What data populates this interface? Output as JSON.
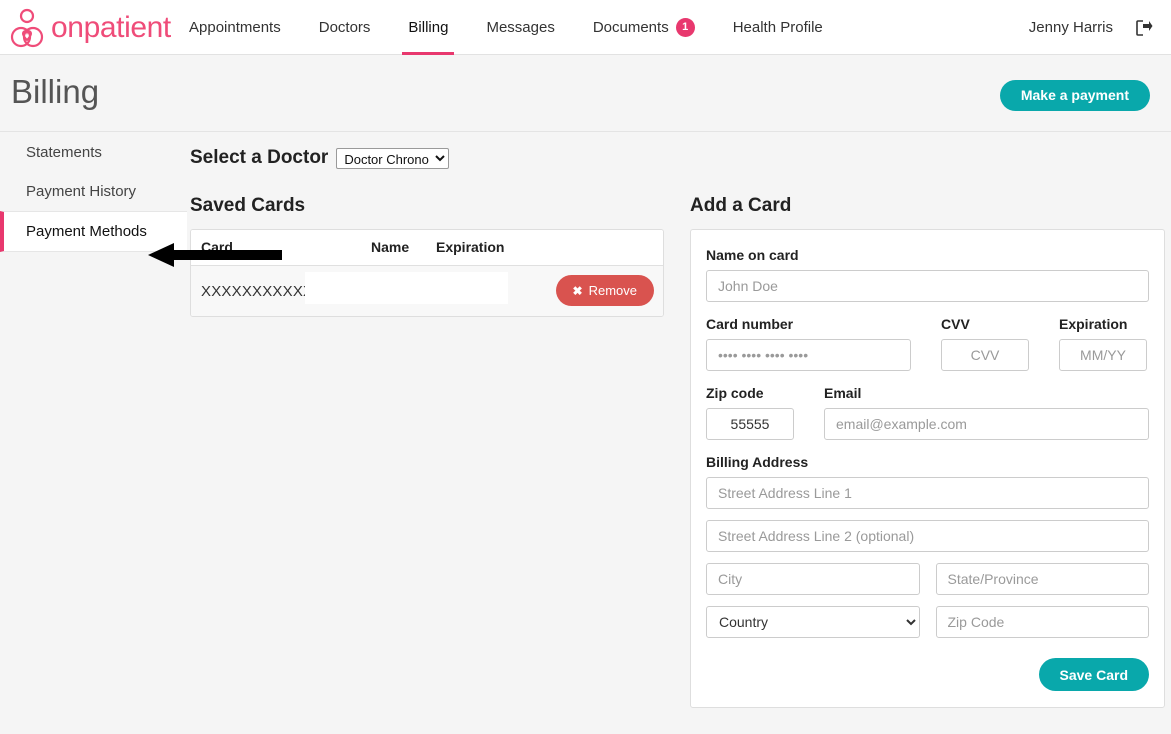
{
  "navbar": {
    "brand": "onpatient",
    "brand_icon": "person-heart-logo-icon",
    "links": [
      {
        "label": "Appointments",
        "active": false
      },
      {
        "label": "Doctors",
        "active": false
      },
      {
        "label": "Billing",
        "active": true
      },
      {
        "label": "Messages",
        "active": false
      },
      {
        "label": "Documents",
        "active": false,
        "badge": "1"
      },
      {
        "label": "Health Profile",
        "active": false
      }
    ],
    "user_name": "Jenny Harris",
    "logout_icon": "logout-icon"
  },
  "page": {
    "title": "Billing",
    "make_payment_label": "Make a payment"
  },
  "sidebar": {
    "items": [
      {
        "label": "Statements",
        "active": false
      },
      {
        "label": "Payment History",
        "active": false
      },
      {
        "label": "Payment Methods",
        "active": true
      }
    ]
  },
  "doctor": {
    "label": "Select a Doctor",
    "selected": "Doctor Chrono",
    "options": [
      "Doctor Chrono"
    ]
  },
  "saved_cards": {
    "title": "Saved Cards",
    "columns": [
      "Card",
      "Name",
      "Expiration"
    ],
    "rows": [
      {
        "card": "XXXXXXXXXXXX",
        "name": "",
        "expiration": "",
        "remove_label": "Remove",
        "remove_icon": "close-x-icon"
      }
    ]
  },
  "add_card": {
    "title": "Add a Card",
    "name_label": "Name on card",
    "name_placeholder": "John Doe",
    "name_value": "",
    "card_number_label": "Card number",
    "card_number_placeholder": "•••• •••• •••• ••••",
    "card_number_value": "",
    "cvv_label": "CVV",
    "cvv_placeholder": "CVV",
    "cvv_value": "",
    "expiration_label": "Expiration",
    "expiration_placeholder": "MM/YY",
    "expiration_value": "",
    "zip_label": "Zip code",
    "zip_value": "55555",
    "zip_placeholder": "Zip code",
    "email_label": "Email",
    "email_placeholder": "email@example.com",
    "email_value": "",
    "billing_address_label": "Billing Address",
    "street1_placeholder": "Street Address Line 1",
    "street1_value": "",
    "street2_placeholder": "Street Address Line 2 (optional)",
    "street2_value": "",
    "city_placeholder": "City",
    "city_value": "",
    "state_placeholder": "State/Province",
    "state_value": "",
    "country_selected": "Country",
    "country_options": [
      "Country"
    ],
    "zipcode_placeholder": "Zip Code",
    "zipcode_value": "",
    "save_label": "Save Card"
  },
  "colors": {
    "brand_pink": "#ef4c79",
    "accent_pink": "#e8386e",
    "teal": "#09a8ab",
    "danger_red": "#d9534f",
    "page_bg": "#f5f5f5"
  }
}
